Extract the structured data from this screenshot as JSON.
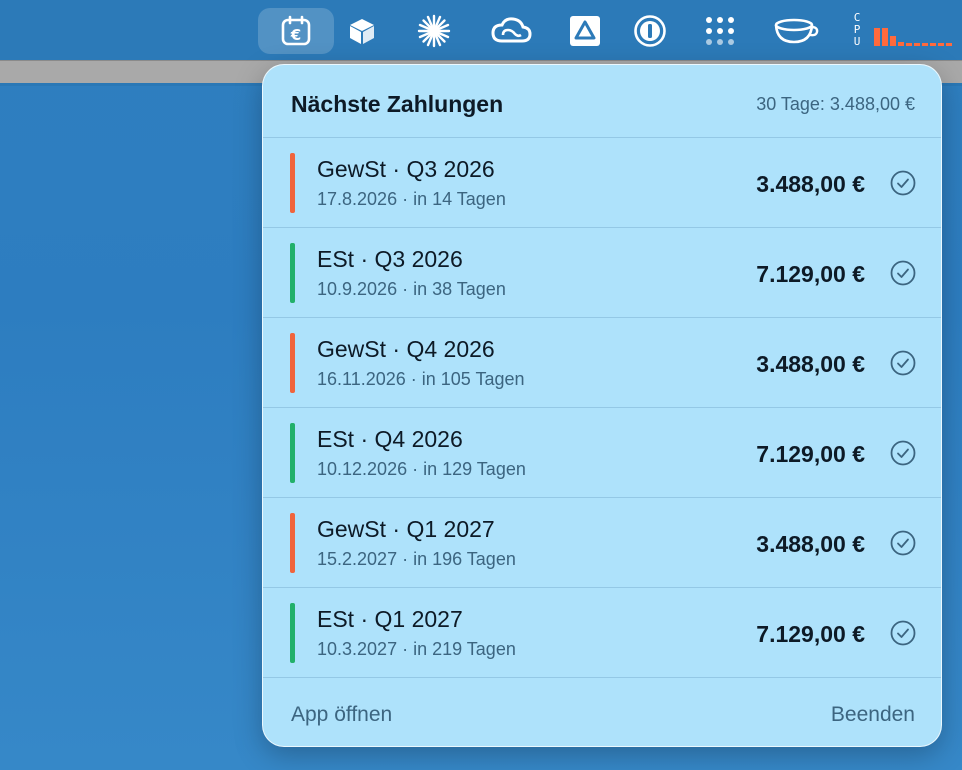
{
  "menubar": {
    "icons": [
      {
        "name": "calendar-euro-icon",
        "active": true
      },
      {
        "name": "cube-icon"
      },
      {
        "name": "asterisk-burst-icon"
      },
      {
        "name": "creative-cloud-icon"
      },
      {
        "name": "drive-triangle-icon"
      },
      {
        "name": "password-manager-icon"
      },
      {
        "name": "dot-grid-icon"
      },
      {
        "name": "cup-icon"
      }
    ],
    "cpu_label": [
      "C",
      "P",
      "U"
    ],
    "cpu_color": "#ff6a3d"
  },
  "popover": {
    "title": "Nächste Zahlungen",
    "summary": "30 Tage: 3.488,00 €",
    "payments": [
      {
        "title": "GewSt · Q3 2026",
        "subtitle": "17.8.2026 · in 14 Tagen",
        "amount": "3.488,00 €",
        "color": "#f0643c"
      },
      {
        "title": "ESt · Q3 2026",
        "subtitle": "10.9.2026 · in 38 Tagen",
        "amount": "7.129,00 €",
        "color": "#22b06a"
      },
      {
        "title": "GewSt · Q4 2026",
        "subtitle": "16.11.2026 · in 105 Tagen",
        "amount": "3.488,00 €",
        "color": "#f0643c"
      },
      {
        "title": "ESt · Q4 2026",
        "subtitle": "10.12.2026 · in 129 Tagen",
        "amount": "7.129,00 €",
        "color": "#22b06a"
      },
      {
        "title": "GewSt · Q1 2027",
        "subtitle": "15.2.2027 · in 196 Tagen",
        "amount": "3.488,00 €",
        "color": "#f0643c"
      },
      {
        "title": "ESt · Q1 2027",
        "subtitle": "10.3.2027 · in 219 Tagen",
        "amount": "7.129,00 €",
        "color": "#22b06a"
      }
    ],
    "footer": {
      "open_app": "App öffnen",
      "quit": "Beenden"
    }
  }
}
